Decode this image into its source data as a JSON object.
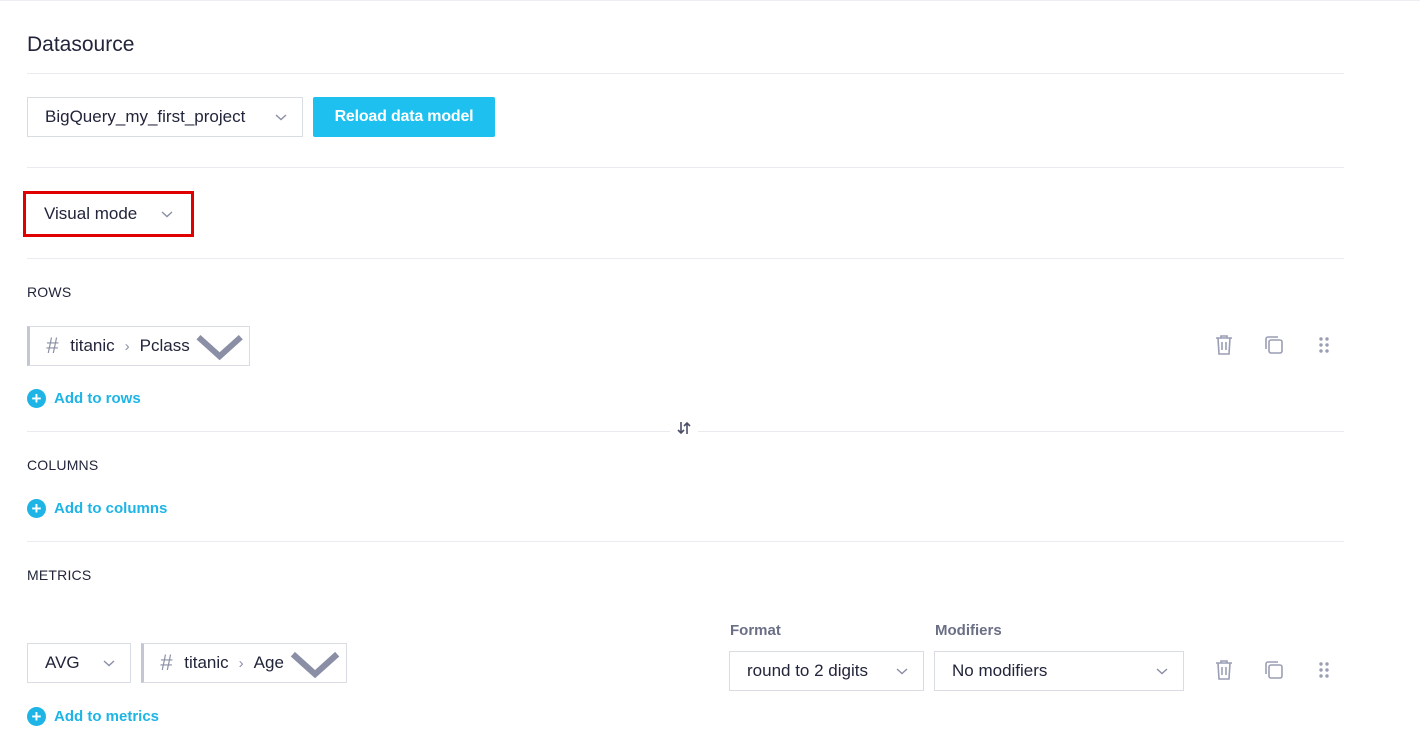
{
  "datasource": {
    "title": "Datasource",
    "selected": "BigQuery_my_first_project",
    "reload_label": "Reload data model"
  },
  "mode": {
    "selected": "Visual mode"
  },
  "rows": {
    "label": "ROWS",
    "items": [
      {
        "table": "titanic",
        "field": "Pclass",
        "icon": "hash-icon"
      }
    ],
    "add_label": "Add to rows"
  },
  "swap_icon": "⇅",
  "columns": {
    "label": "COLUMNS",
    "add_label": "Add to columns"
  },
  "metrics": {
    "label": "METRICS",
    "items": [
      {
        "aggregation": "AVG",
        "table": "titanic",
        "field": "Age",
        "format_label": "Format",
        "format_value": "round to 2 digits",
        "modifiers_label": "Modifiers",
        "modifiers_value": "No modifiers"
      }
    ],
    "add_label": "Add to metrics"
  },
  "colors": {
    "accent": "#1ec0f0",
    "highlight": "#e00000",
    "text": "#22253a",
    "icon": "#8b8fa6"
  }
}
